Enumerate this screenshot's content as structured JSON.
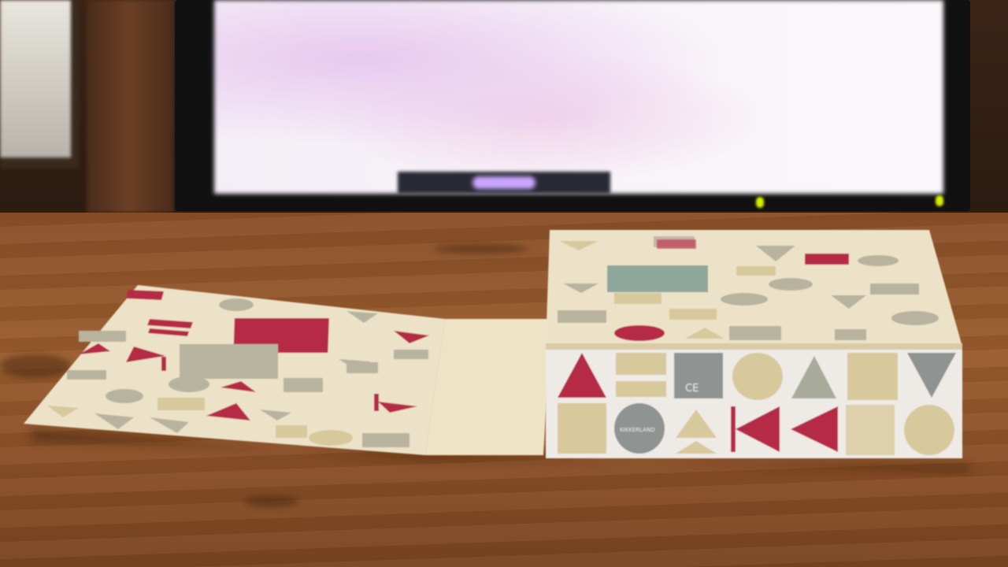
{
  "scene": {
    "description_tags": [
      "monitor",
      "wooden-desk",
      "window",
      "curtain",
      "patterned-box"
    ],
    "colors": {
      "wood": "#9a5c2e",
      "box_cream": "#efe6d2",
      "shape_red": "#b52a44",
      "shape_grey": "#a9ab9a",
      "shape_beige": "#d8c99c",
      "screen": "#f6f0f7"
    }
  },
  "box": {
    "logo_text": "KIKKERLAND",
    "ce_mark": "CE"
  }
}
